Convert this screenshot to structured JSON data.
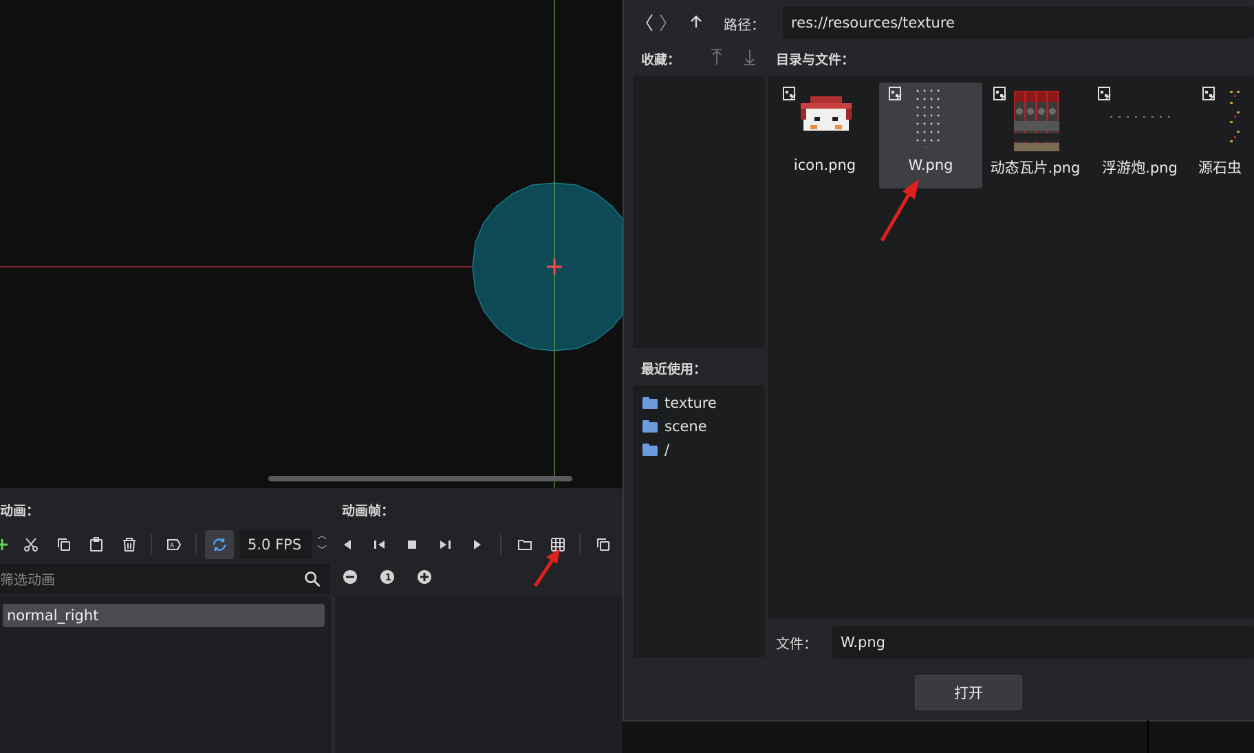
{
  "bottom_panel": {
    "animations_label": "动画：",
    "frames_label": "动画帧：",
    "fps": "5.0 FPS",
    "filter_placeholder": "筛选动画",
    "animations": [
      {
        "name": "normal_right"
      }
    ]
  },
  "file_dialog": {
    "path_label": "路径：",
    "path_value": "res://resources/texture",
    "favorites_label": "收藏：",
    "dirs_files_label": "目录与文件：",
    "recent_label": "最近使用：",
    "recent": [
      "texture",
      "scene",
      "/"
    ],
    "files": [
      {
        "name": "icon.png"
      },
      {
        "name": "W.png",
        "selected": true
      },
      {
        "name": "动态瓦片.png"
      },
      {
        "name": "浮游炮.png"
      },
      {
        "name": "源石虫"
      }
    ],
    "file_label": "文件：",
    "file_value": "W.png",
    "open_button": "打开"
  },
  "colors": {
    "annotation_arrow": "#e02020",
    "selection_circle": "#0d4a55",
    "folder_icon": "#6c9ce0"
  }
}
